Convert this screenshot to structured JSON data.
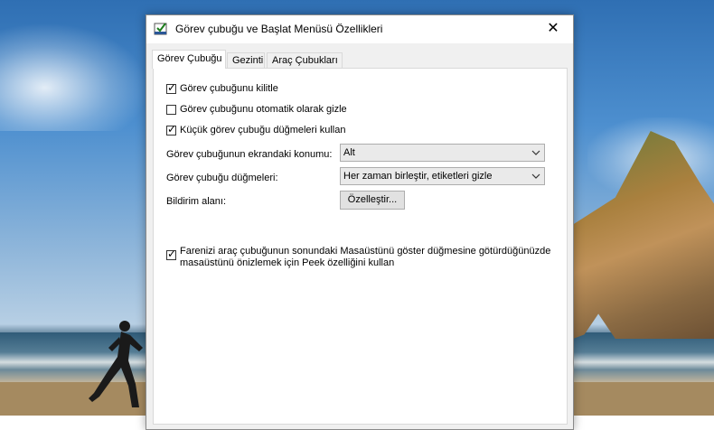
{
  "window": {
    "title": "Görev çubuğu ve Başlat Menüsü Özellikleri",
    "close_label": "✕"
  },
  "tabs": [
    {
      "label": "Görev Çubuğu",
      "active": true
    },
    {
      "label": "Gezinti",
      "active": false
    },
    {
      "label": "Araç Çubukları",
      "active": false
    }
  ],
  "taskbar": {
    "lock_label": "Görev çubuğunu kilitle",
    "lock_checked": true,
    "autohide_label": "Görev çubuğunu otomatik olarak gizle",
    "autohide_checked": false,
    "small_buttons_label": "Küçük görev çubuğu düğmeleri kullan",
    "small_buttons_checked": true,
    "location_label": "Görev çubuğunun ekrandaki konumu:",
    "location_value": "Alt",
    "buttons_label": "Görev çubuğu düğmeleri:",
    "buttons_value": "Her zaman birleştir, etiketleri gizle",
    "notification_label": "Bildirim alanı:",
    "customize_button": "Özelleştir...",
    "peek_label_line1": "Farenizi araç çubuğunun sonundaki Masaüstünü göster düğmesine götürdüğünüzde",
    "peek_label_line2": "masaüstünü önizlemek için Peek özelliğini kullan",
    "peek_checked": true
  },
  "check_glyph": "✓"
}
